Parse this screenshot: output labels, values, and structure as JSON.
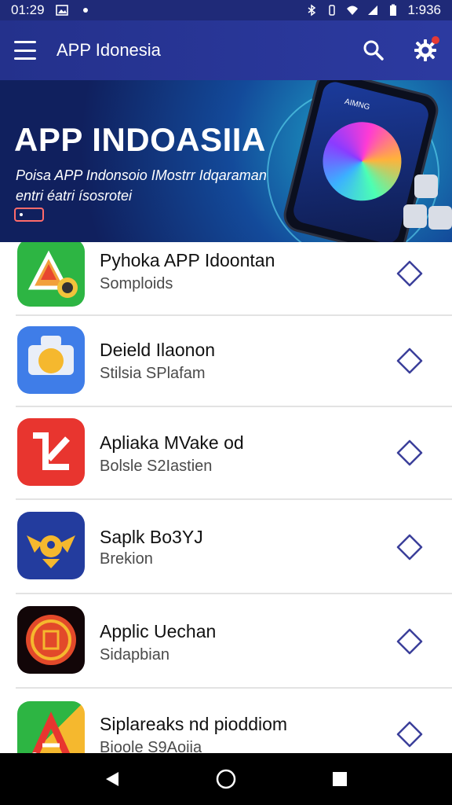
{
  "status_bar": {
    "time_left": "01:29",
    "time_right": "1:936",
    "icons": [
      "photo-icon",
      "dot-icon",
      "bluetooth-icon",
      "vibrate-icon",
      "wifi-icon",
      "signal-icon",
      "battery-icon"
    ]
  },
  "app_bar": {
    "title": "APP Idonesia",
    "icons": [
      "menu-icon",
      "search-icon",
      "settings-icon"
    ],
    "accent": "#2c3aa0"
  },
  "banner": {
    "title": "APP INDOASIIA",
    "subtitle": "Poisa APP Indonsoio IMostrr Idqaraman entri éatri ísosrotei",
    "phone_label": "AIMNG"
  },
  "apps": [
    {
      "name": "Pyhoka APP Idoontan",
      "subtitle": "Somploids",
      "icon": "triangle-logo-icon"
    },
    {
      "name": "Deield Ilaonon",
      "subtitle": "Stilsia SPlafam",
      "icon": "sun-puzzle-icon"
    },
    {
      "name": "Apliaka MVake od",
      "subtitle": "Bolsle S2Iastien",
      "icon": "z-logo-icon"
    },
    {
      "name": "Saplk Bo3YJ",
      "subtitle": "Brekion",
      "icon": "winged-emblem-icon"
    },
    {
      "name": "Applic Uechan",
      "subtitle": "Sidapbian",
      "icon": "coin-emblem-icon"
    },
    {
      "name": "Siplareaks nd pioddiom",
      "subtitle": "Bioole S9Aoiia",
      "icon": "triangle-path-icon"
    }
  ],
  "nav": {
    "icons": [
      "back-icon",
      "home-icon",
      "recents-icon"
    ]
  }
}
